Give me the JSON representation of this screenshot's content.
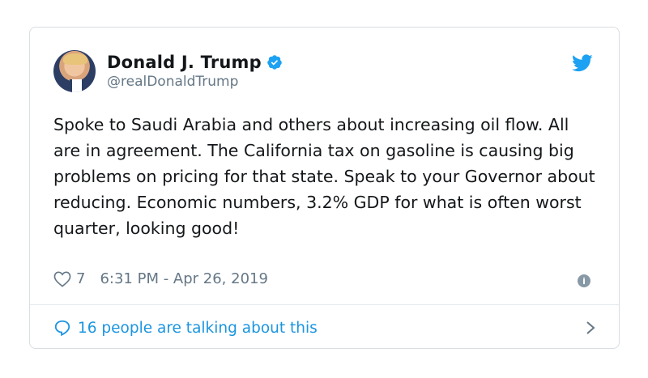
{
  "author": {
    "display_name": "Donald J. Trump",
    "handle": "@realDonaldTrump",
    "verified": true
  },
  "tweet": {
    "text": "Spoke to Saudi Arabia and others about increasing oil flow. All are in agreement. The California tax on gasoline is causing big problems on pricing for that state. Speak to your Governor about reducing. Economic numbers, 3.2% GDP for what is often worst quarter, looking good!",
    "like_count": "7",
    "timestamp": "6:31 PM - Apr 26, 2019"
  },
  "footer": {
    "conversation_label": "16 people are talking about this"
  },
  "icons": {
    "brand": "twitter-bird-icon",
    "verified": "verified-badge-icon",
    "like": "heart-icon",
    "info": "info-icon",
    "reply": "speech-bubble-icon",
    "navigate": "chevron-right-icon"
  },
  "colors": {
    "brand_blue": "#1da1f2",
    "link_blue": "#1b95e0",
    "muted": "#657786",
    "text": "#14171a",
    "border": "#d8dee3"
  }
}
